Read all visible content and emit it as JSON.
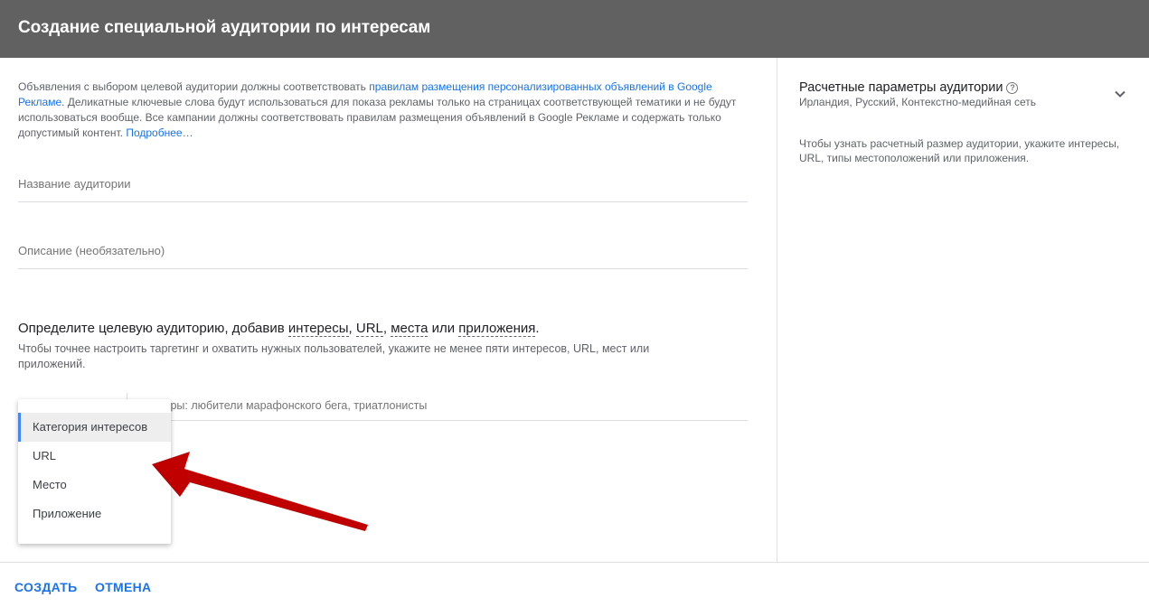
{
  "header": {
    "title": "Создание специальной аудитории по интересам"
  },
  "notice": {
    "text1": "Объявления с выбором целевой аудитории должны соответствовать ",
    "link1": "правилам размещения персонализированных объявлений в Google Рекламе",
    "text2": ". Деликатные ключевые слова будут использоваться для показа рекламы только на страницах соответствующей тематики и не будут использоваться вообще. Все кампании должны соответствовать правилам размещения объявлений в Google Рекламе и содержать только допустимый контент. ",
    "link2": "Подробнее…"
  },
  "fields": {
    "name_placeholder": "Название аудитории",
    "description_placeholder": "Описание (необязательно)"
  },
  "targeting": {
    "title_prefix": "Определите целевую аудиторию, добавив ",
    "link_interests": "интересы",
    "sep1": ", ",
    "link_url": "URL",
    "sep2": ", ",
    "link_places": "места",
    "sep3": " или ",
    "link_apps": "приложения",
    "title_suffix": ".",
    "hint": "Чтобы точнее настроить таргетинг и охватить нужных пользователей, укажите не менее пяти интересов, URL, мест или приложений.",
    "search_placeholder": "Примеры: любители марафонского бега, триатлонисты"
  },
  "dropdown": {
    "items": [
      {
        "label": "Категория интересов",
        "selected": true
      },
      {
        "label": "URL",
        "selected": false
      },
      {
        "label": "Место",
        "selected": false
      },
      {
        "label": "Приложение",
        "selected": false
      }
    ]
  },
  "estimate": {
    "title": "Расчетные параметры аудитории",
    "help_icon": "?",
    "subtitle": "Ирландия, Русский, Контекстно-медийная сеть",
    "note": "Чтобы узнать расчетный размер аудитории, укажите интересы, URL, типы местоположений или приложения."
  },
  "footer": {
    "create_label": "СОЗДАТЬ",
    "cancel_label": "ОТМЕНА"
  },
  "colors": {
    "header_bg": "#616161",
    "link": "#1a73e8",
    "selected_marker": "#4285f4",
    "annotation_arrow": "#c00000"
  },
  "icons": [
    "help-icon",
    "chevron-down-icon",
    "annotation-arrow"
  ]
}
